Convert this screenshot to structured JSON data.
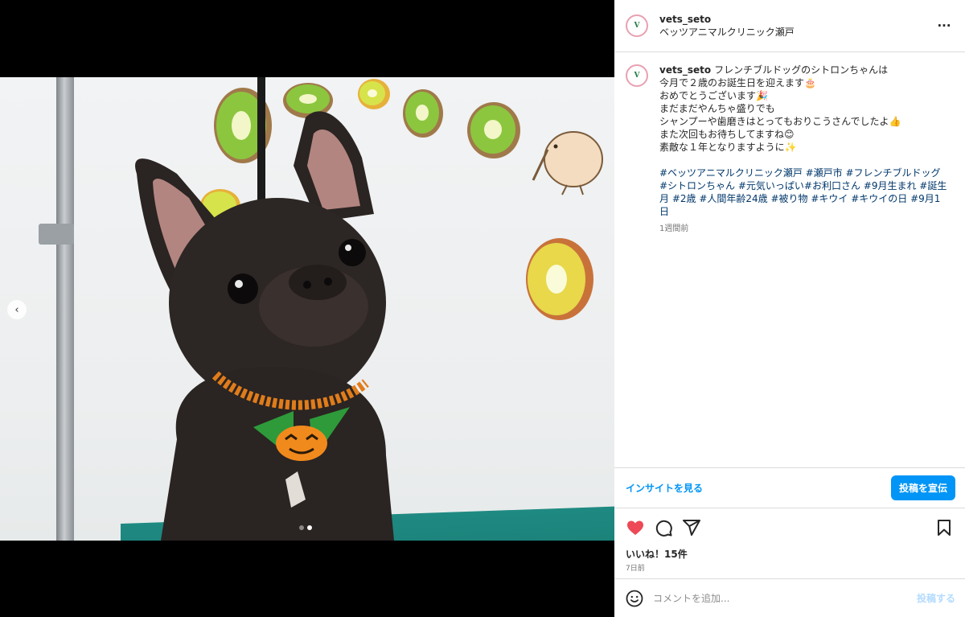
{
  "header": {
    "username": "vets_seto",
    "location": "ベッツアニマルクリニック瀬戸",
    "more_icon": "more-horizontal-icon"
  },
  "caption": {
    "username": "vets_seto",
    "lines": [
      "フレンチブルドッグのシトロンちゃんは",
      "今月で２歳のお誕生日を迎えます🎂",
      "おめでとうございます🎉",
      "まだまだやんちゃ盛りでも",
      "シャンプーや歯磨きはとってもおりこうさんでしたよ👍",
      "また次回もお待ちしてますね😊",
      "素敵な１年となりますように✨"
    ],
    "hashtags": "#ベッツアニマルクリニック瀬戸 #瀬戸市 #フレンチブルドッグ #シトロンちゃん #元気いっぱい#お利口さん #9月生まれ #誕生月 #2歳 #人間年齢24歳 #被り物 #キウイ #キウイの日 #9月1日",
    "time_ago": "1週間前"
  },
  "insight": {
    "link_label": "インサイトを見る",
    "promote_label": "投稿を宣伝"
  },
  "actions": {
    "likes": "いいね！15件",
    "date": "7日前",
    "liked_color": "#ed4956"
  },
  "comment": {
    "placeholder": "コメントを追加...",
    "post_label": "投稿する"
  },
  "carousel": {
    "prev_icon": "chevron-left-icon",
    "slide_count": 2,
    "active_slide": 2
  }
}
